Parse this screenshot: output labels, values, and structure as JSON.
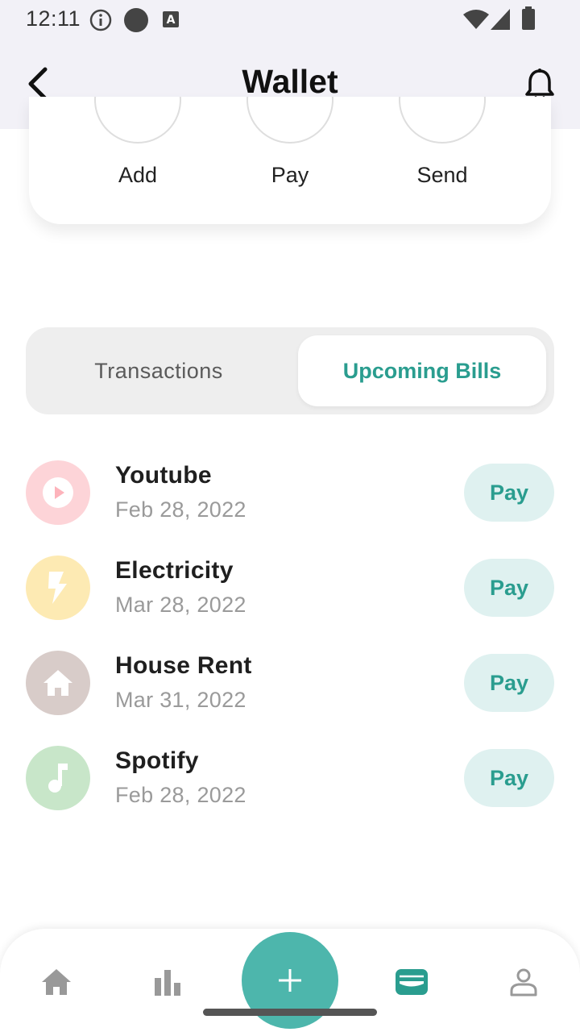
{
  "status_bar": {
    "time": "12:11",
    "icons": [
      "info-icon",
      "dot-icon",
      "a-icon",
      "wifi-icon",
      "signal-icon",
      "battery-icon"
    ]
  },
  "app_bar": {
    "title": "Wallet",
    "back_icon": "back-arrow-icon",
    "bell_icon": "bell-icon"
  },
  "actions": [
    {
      "label": "Add"
    },
    {
      "label": "Pay"
    },
    {
      "label": "Send"
    }
  ],
  "tabs": {
    "transactions": "Transactions",
    "upcoming_bills": "Upcoming Bills",
    "selected": "upcoming_bills"
  },
  "bills": [
    {
      "name": "Youtube",
      "date": "Feb 28, 2022",
      "action": "Pay",
      "icon": "play-icon",
      "icon_bg": "#fdd4d8"
    },
    {
      "name": "Electricity",
      "date": "Mar 28, 2022",
      "action": "Pay",
      "icon": "lightning-icon",
      "icon_bg": "#fdeab3"
    },
    {
      "name": "House Rent",
      "date": "Mar 31, 2022",
      "action": "Pay",
      "icon": "house-icon",
      "icon_bg": "#d8ccc9"
    },
    {
      "name": "Spotify",
      "date": "Feb 28, 2022",
      "action": "Pay",
      "icon": "music-note-icon",
      "icon_bg": "#c8e6c9"
    }
  ],
  "bottom_nav": {
    "items": [
      "home-icon",
      "chart-icon",
      "add-icon",
      "wallet-icon",
      "profile-icon"
    ],
    "active": "wallet-icon"
  },
  "colors": {
    "accent": "#2a9d8f",
    "fab": "#4db6ac",
    "pay_bg": "#dff1f0",
    "header_bg": "#f2f1f7"
  }
}
